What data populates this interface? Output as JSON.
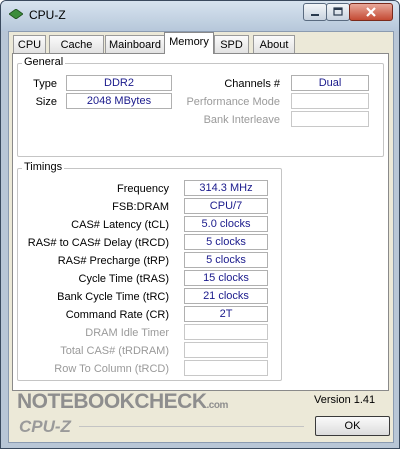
{
  "window": {
    "title": "CPU-Z"
  },
  "tabs": [
    "CPU",
    "Cache",
    "Mainboard",
    "Memory",
    "SPD",
    "About"
  ],
  "active_tab": "Memory",
  "general": {
    "label": "General",
    "type_label": "Type",
    "type_value": "DDR2",
    "size_label": "Size",
    "size_value": "2048 MBytes",
    "channels_label": "Channels #",
    "channels_value": "Dual",
    "perf_mode_label": "Performance Mode",
    "perf_mode_value": "",
    "bank_interleave_label": "Bank Interleave",
    "bank_interleave_value": ""
  },
  "timings": {
    "label": "Timings",
    "rows": [
      {
        "label": "Frequency",
        "value": "314.3 MHz",
        "enabled": true
      },
      {
        "label": "FSB:DRAM",
        "value": "CPU/7",
        "enabled": true
      },
      {
        "label": "CAS# Latency (tCL)",
        "value": "5.0 clocks",
        "enabled": true
      },
      {
        "label": "RAS# to CAS# Delay (tRCD)",
        "value": "5 clocks",
        "enabled": true
      },
      {
        "label": "RAS# Precharge (tRP)",
        "value": "5 clocks",
        "enabled": true
      },
      {
        "label": "Cycle Time (tRAS)",
        "value": "15 clocks",
        "enabled": true
      },
      {
        "label": "Bank Cycle Time (tRC)",
        "value": "21 clocks",
        "enabled": true
      },
      {
        "label": "Command Rate (CR)",
        "value": "2T",
        "enabled": true
      },
      {
        "label": "DRAM Idle Timer",
        "value": "",
        "enabled": false
      },
      {
        "label": "Total CAS# (tRDRAM)",
        "value": "",
        "enabled": false
      },
      {
        "label": "Row To Column (tRCD)",
        "value": "",
        "enabled": false
      }
    ]
  },
  "footer": {
    "watermark": "NOTEBOOKCHECK",
    "watermark_suffix": ".com",
    "version": "Version 1.41",
    "brand": "CPU-Z",
    "ok_label": "OK"
  },
  "colors": {
    "value_text": "#1a1a8c",
    "disabled_text": "#9a9a9a"
  },
  "icons": {
    "app": "cpu-z-app-icon",
    "minimize": "minimize-icon",
    "maximize": "maximize-icon",
    "close": "close-icon"
  }
}
